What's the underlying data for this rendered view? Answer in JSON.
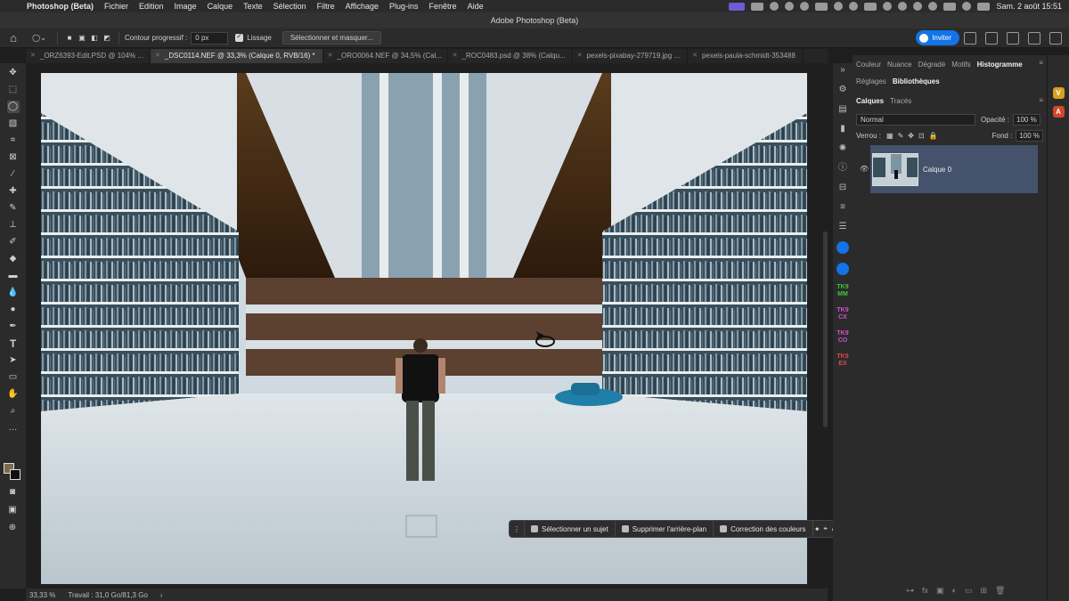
{
  "menubar": {
    "app_name": "Photoshop (Beta)",
    "menus": [
      "Fichier",
      "Edition",
      "Image",
      "Calque",
      "Texte",
      "Sélection",
      "Filtre",
      "Affichage",
      "Plug-ins",
      "Fenêtre",
      "Aide"
    ],
    "clock": "Sam. 2 août  15:51"
  },
  "window": {
    "title": "Adobe Photoshop (Beta)"
  },
  "options": {
    "feather_label": "Contour progressif :",
    "feather_value": "0 px",
    "smoothing_label": "Lissage",
    "select_mask_label": "Sélectionner et masquer...",
    "invite_label": "Inviter"
  },
  "tabs": [
    {
      "label": "_ORZ6393-Edit.PSD @ 104% ..."
    },
    {
      "label": "_DSC0114.NEF @ 33,3% (Calque 0, RVB/16) *"
    },
    {
      "label": "_ORO0064.NEF @ 34,5% (Cal..."
    },
    {
      "label": "_ROC0483.psd @ 38% (Calqu..."
    },
    {
      "label": "pexels-pixabay-279719.jpg ..."
    },
    {
      "label": "pexels-paula-schmidt-353488"
    }
  ],
  "taskbar": {
    "select_subject": "Sélectionner un sujet",
    "remove_bg": "Supprimer l'arrière-plan",
    "color_correction": "Correction des couleurs"
  },
  "statusbar": {
    "zoom": "33,33 %",
    "work": "Travail : 31,0 Go/81,3 Go"
  },
  "panels": {
    "top_tabs": [
      "Couleur",
      "Nuance",
      "Dégradé",
      "Motifs",
      "Histogramme"
    ],
    "second_tabs": [
      "Réglages",
      "Bibliothèques"
    ],
    "layer_tabs": [
      "Calques",
      "Tracés"
    ],
    "blend_mode": "Normal",
    "opacity_label": "Opacité :",
    "opacity_value": "100 %",
    "lock_label": "Verrou :",
    "fill_label": "Fond :",
    "fill_value": "100 %",
    "layer_name": "Calque 0"
  },
  "strip_plugins": [
    "TK9 MM",
    "TK9 CX",
    "TK9 CO",
    "TK9 EX"
  ],
  "colors": {
    "accent": "#1473e6",
    "layer_selected": "#44526b",
    "foreground": "#7b6a4e",
    "background": "#111111"
  }
}
